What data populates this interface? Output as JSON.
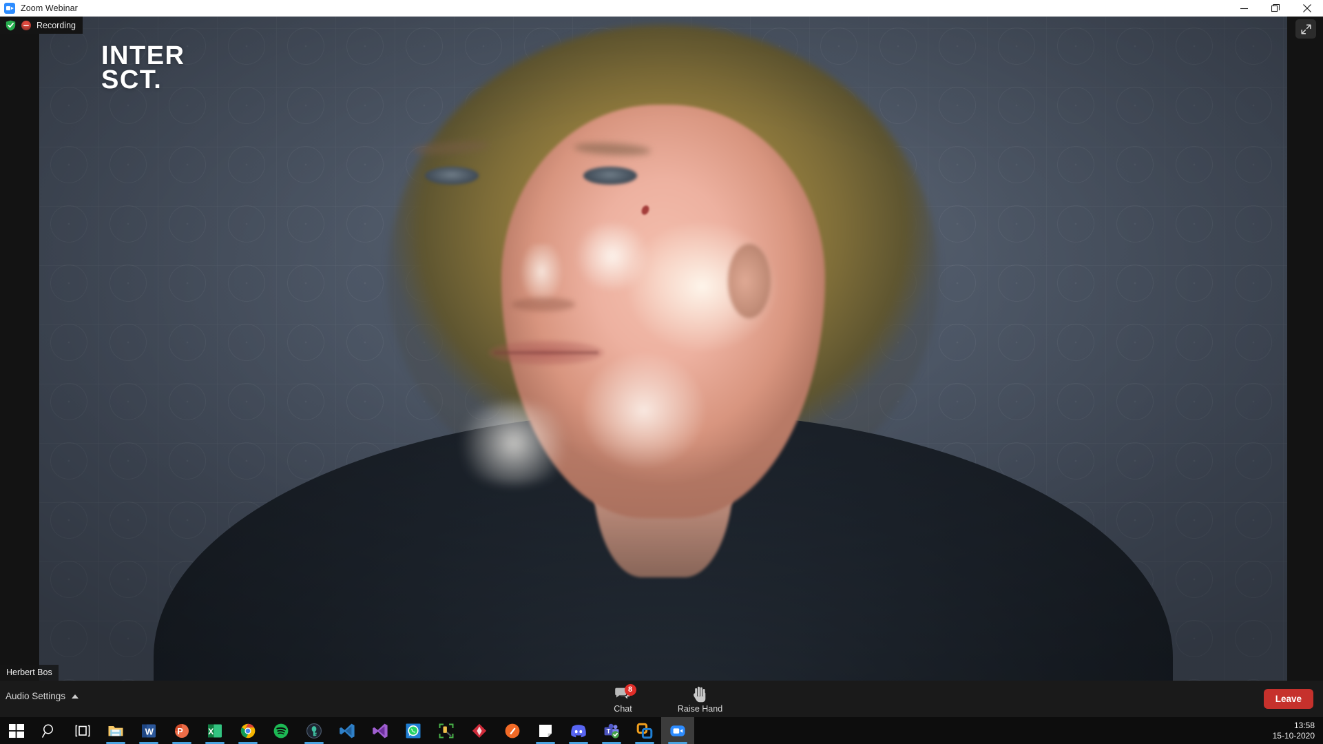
{
  "window": {
    "title": "Zoom Webinar",
    "app_icon": "zoom-camera-icon",
    "controls": {
      "minimize": "minimize-icon",
      "maximize": "maximize-icon",
      "close": "close-icon"
    }
  },
  "status": {
    "encryption_icon": "green-shield-icon",
    "recording_icon": "recording-dot-icon",
    "recording_label": "Recording",
    "fullscreen_icon": "enter-fullscreen-icon"
  },
  "video": {
    "logo_line1": "INTER",
    "logo_line2": "SCT.",
    "participant_name": "Herbert Bos"
  },
  "toolbar": {
    "audio_settings_label": "Audio Settings",
    "audio_chevron_icon": "chevron-up-icon",
    "items": [
      {
        "label": "Chat",
        "icon": "chat-bubble-icon",
        "badge": "8"
      },
      {
        "label": "Raise Hand",
        "icon": "raise-hand-icon",
        "badge": ""
      }
    ],
    "leave_label": "Leave"
  },
  "taskbar": {
    "items": [
      {
        "name": "start-button",
        "icon": "windows-logo-icon",
        "active": false
      },
      {
        "name": "search-button",
        "icon": "search-icon",
        "active": false
      },
      {
        "name": "task-view-button",
        "icon": "task-view-icon",
        "active": false
      },
      {
        "name": "file-explorer",
        "icon": "folder-icon",
        "active": true
      },
      {
        "name": "word",
        "icon": "word-icon",
        "active": true
      },
      {
        "name": "powerpoint",
        "icon": "powerpoint-icon",
        "active": true
      },
      {
        "name": "excel",
        "icon": "excel-icon",
        "active": true
      },
      {
        "name": "chrome",
        "icon": "chrome-icon",
        "active": true
      },
      {
        "name": "spotify",
        "icon": "spotify-icon",
        "active": false
      },
      {
        "name": "keepass",
        "icon": "keepass-icon",
        "active": true
      },
      {
        "name": "vscode",
        "icon": "vscode-icon",
        "active": false
      },
      {
        "name": "visual-studio",
        "icon": "visual-studio-icon",
        "active": false
      },
      {
        "name": "whatsapp",
        "icon": "whatsapp-icon",
        "active": false
      },
      {
        "name": "snip-tool",
        "icon": "snip-tool-icon",
        "active": false
      },
      {
        "name": "red-diamond-app",
        "icon": "red-diamond-icon",
        "active": false
      },
      {
        "name": "orange-pen-app",
        "icon": "orange-pen-icon",
        "active": false
      },
      {
        "name": "sticky-notes",
        "icon": "sticky-notes-icon",
        "active": true
      },
      {
        "name": "discord",
        "icon": "discord-icon",
        "active": true
      },
      {
        "name": "microsoft-teams",
        "icon": "teams-icon",
        "active": true
      },
      {
        "name": "vmware",
        "icon": "vmware-icon",
        "active": true
      },
      {
        "name": "zoom",
        "icon": "zoom-icon",
        "active": true
      }
    ],
    "clock_time": "13:58",
    "clock_date": "15-10-2020"
  },
  "colors": {
    "accent_blue": "#2d8cff",
    "leave_red": "#c6312c",
    "badge_red": "#e02d28",
    "shield_green": "#27ae4e",
    "taskbar_underline": "#4aa3e0",
    "video_background": "#4d5766"
  }
}
